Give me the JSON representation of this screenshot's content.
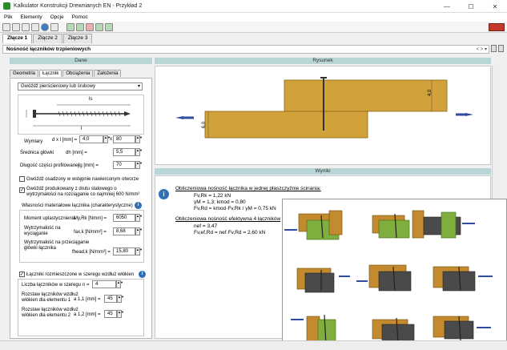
{
  "window": {
    "title": "Kalkulator Konstrukcji Drewnianych EN - Przykład 2"
  },
  "menu": [
    "Plik",
    "Elementy",
    "Opcje",
    "Pomoc"
  ],
  "file_tabs": [
    "Złącze 1",
    "Złącze 2",
    "Złącze 3"
  ],
  "section": {
    "title": "Nośność łączników trzpieniowych"
  },
  "panels": {
    "left_header": "Dane",
    "right_header": "Rysunek",
    "results_header": "Wyniki"
  },
  "left_tabs": [
    "Geometria",
    "Łącznik",
    "Obciążenia",
    "Założenia"
  ],
  "fastener": {
    "type": "Gwóźdź pierścieniowy lub śrubowy",
    "dim_label": "ls",
    "len_label": "l",
    "wymiary_label": "Wymiary",
    "dxl_label": "d x l  [mm] =",
    "d": "4,0",
    "x_sep": "x",
    "l": "80",
    "glowka_label": "Średnica główki",
    "dh_label": "dh [mm] =",
    "dh": "5,5",
    "dlugosc_label": "Długość części profilowanej",
    "lg_label": "lg [mm] =",
    "lg": "70",
    "chk1": "Gwóźdź osadzony w wstępnie nawierconym otworze",
    "chk2_line1": "Gwóźdź produkowany z drutu stalowego o",
    "chk2_line2": "wytrzymałości na rozciąganie co najmniej  600 N/mm²"
  },
  "material": {
    "title": "Własności materiałowe łącznika (charakterystyczne)",
    "moment_label": "Moment uplastycznienia",
    "my_label": "My,Rk [Nmm] =",
    "my": "6050",
    "wyc_label1": "Wytrzymałość na",
    "wyc_label2": "wyciąganie",
    "fax_label": "fax,k [N/mm²] =",
    "fax": "8,68",
    "head_label1": "Wytrzymałość na przeciąganie",
    "head_label2": "główki łącznika",
    "fhead_label": "fhead,k [N/mm²] =",
    "fhead": "15,80"
  },
  "arrangement": {
    "chk": "Łączniki rozmieszczone w szeregu wzdłuż włókien",
    "n_label": "Liczba łączników w szeregu",
    "n_sym": "n =",
    "n": "4",
    "a11_label1": "Rozstaw łączników wzdłuż",
    "a11_label2": "włókien dla elementu 1",
    "a11_sym": "a 1,1 [mm] =",
    "a11": "45",
    "a12_label1": "Rozstaw łączników wzdłuż",
    "a12_label2": "włókien dla elementu 2",
    "a12_sym": "a 1,2 [mm] =",
    "a12": "45"
  },
  "drawing": {
    "dim_top": "4,0",
    "dim_left": "6,0"
  },
  "results": {
    "line1": "Obliczeniowa nośność łącznika w jednej płaszczyźnie ścinania:",
    "line2": "Fv,Rk = 1,22 kN",
    "line3": "γM = 1,3;  kmod = 0,80",
    "line4": "Fv,Rd = kmod·Fv,Rk / γM = 0,75 kN",
    "line5": "Obliczeniowa nośność efektywna 4 łączników",
    "line6": "nef = 3,47",
    "line7": "Fv,ef,Rd = nef·Fv,Rd = 2,60 kN"
  },
  "colors": {
    "wood": "#d2a23a",
    "wood_dark": "#8a6416",
    "arrow": "#2f4d9c",
    "header": "#b9d6d6",
    "info": "#2f6fb5"
  }
}
